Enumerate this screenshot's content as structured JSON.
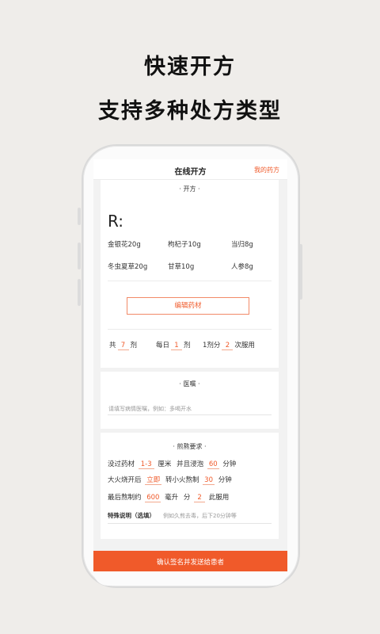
{
  "headline": {
    "line1": "快速开方",
    "line2": "支持多种处方类型"
  },
  "topbar": {
    "title": "在线开方",
    "my_prescriptions": "我的药方"
  },
  "prescription": {
    "section_title": "· 开方 ·",
    "r_mark": "R:",
    "herbs": [
      "金银花20g",
      "枸杞子10g",
      "当归8g",
      "冬虫夏草20g",
      "甘草10g",
      "人参8g"
    ],
    "edit_button": "编辑药材",
    "dose": {
      "total_label": "共",
      "total_value": "7",
      "total_unit": "剂",
      "daily_label": "每日",
      "daily_value": "1",
      "daily_unit": "剂",
      "split_label": "1剂分",
      "split_value": "2",
      "split_unit": "次服用"
    }
  },
  "advice": {
    "section_title": "· 医嘱 ·",
    "placeholder": "请填写病情医嘱，例如：多喝开水"
  },
  "decoction": {
    "section_title": "·    煎熬要求    ·",
    "soak_label": "没过药材",
    "soak_value": "1-3",
    "soak_unit": "厘米",
    "soak_label2": "并且浸泡",
    "soak_time": "60",
    "soak_time_unit": "分钟",
    "boil_label": "大火烧开后",
    "boil_value": "立即",
    "simmer_label": "转小火熬制",
    "simmer_time": "30",
    "simmer_unit": "分钟",
    "final_label": "最后熬制约",
    "final_value": "600",
    "final_unit": "毫升",
    "divide_label": "分",
    "divide_value": "2",
    "divide_unit": "此服用",
    "special_label": "特殊说明（选填）",
    "special_placeholder": "例如久煎去毒，后下20分钟等"
  },
  "confirm_button": "确认签名并发送给患者",
  "colors": {
    "accent": "#f05a2a",
    "background": "#efedea"
  }
}
